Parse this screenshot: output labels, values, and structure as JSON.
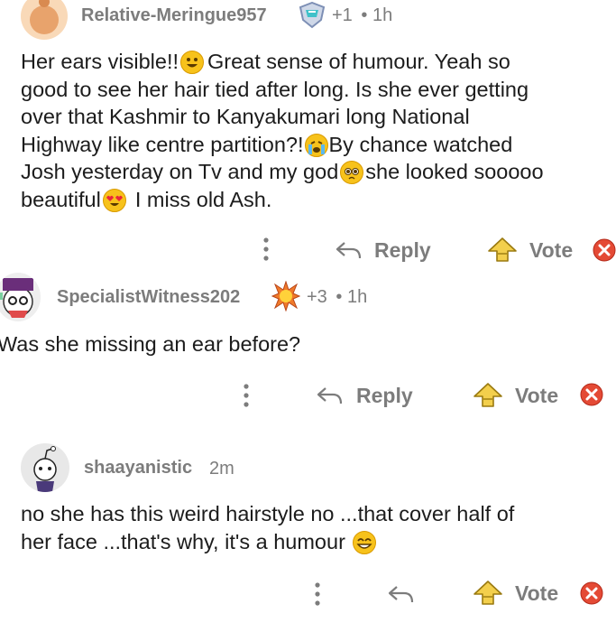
{
  "comments": [
    {
      "username": "Relative-Meringue957",
      "score": "+1",
      "dot": "•",
      "time": "1h",
      "lines": [
        "Her ears visible!!",
        "Great sense of humour. Yeah so",
        "good to see her hair tied after long. Is she ever getting",
        "over that Kashmir to Kanyakumari long National",
        "Highway like centre partition?!",
        "By chance watched",
        "Josh yesterday on Tv and my god",
        "she looked sooooo",
        "beautiful",
        "I miss old Ash."
      ],
      "actions": {
        "reply": "Reply",
        "vote": "Vote"
      }
    },
    {
      "username": "SpecialistWitness202",
      "score": "+3",
      "dot": "•",
      "time": "1h",
      "text": "Was she missing an ear before?",
      "actions": {
        "reply": "Reply",
        "vote": "Vote"
      }
    },
    {
      "username": "shaayanistic",
      "time": "2m",
      "lines": [
        "no she has this weird hairstyle no ...that cover half of",
        "her face ...that's why, it's a humour"
      ],
      "actions": {
        "vote": "Vote"
      }
    }
  ],
  "icons": {
    "more": "vertical-dots-icon",
    "reply": "reply-arrow-icon",
    "vote": "upvote-arrow-icon",
    "close": "close-x-icon"
  },
  "colors": {
    "vote_gold": "#e8b91a",
    "close_red": "#e44a35",
    "gray": "#7c7c7c"
  }
}
